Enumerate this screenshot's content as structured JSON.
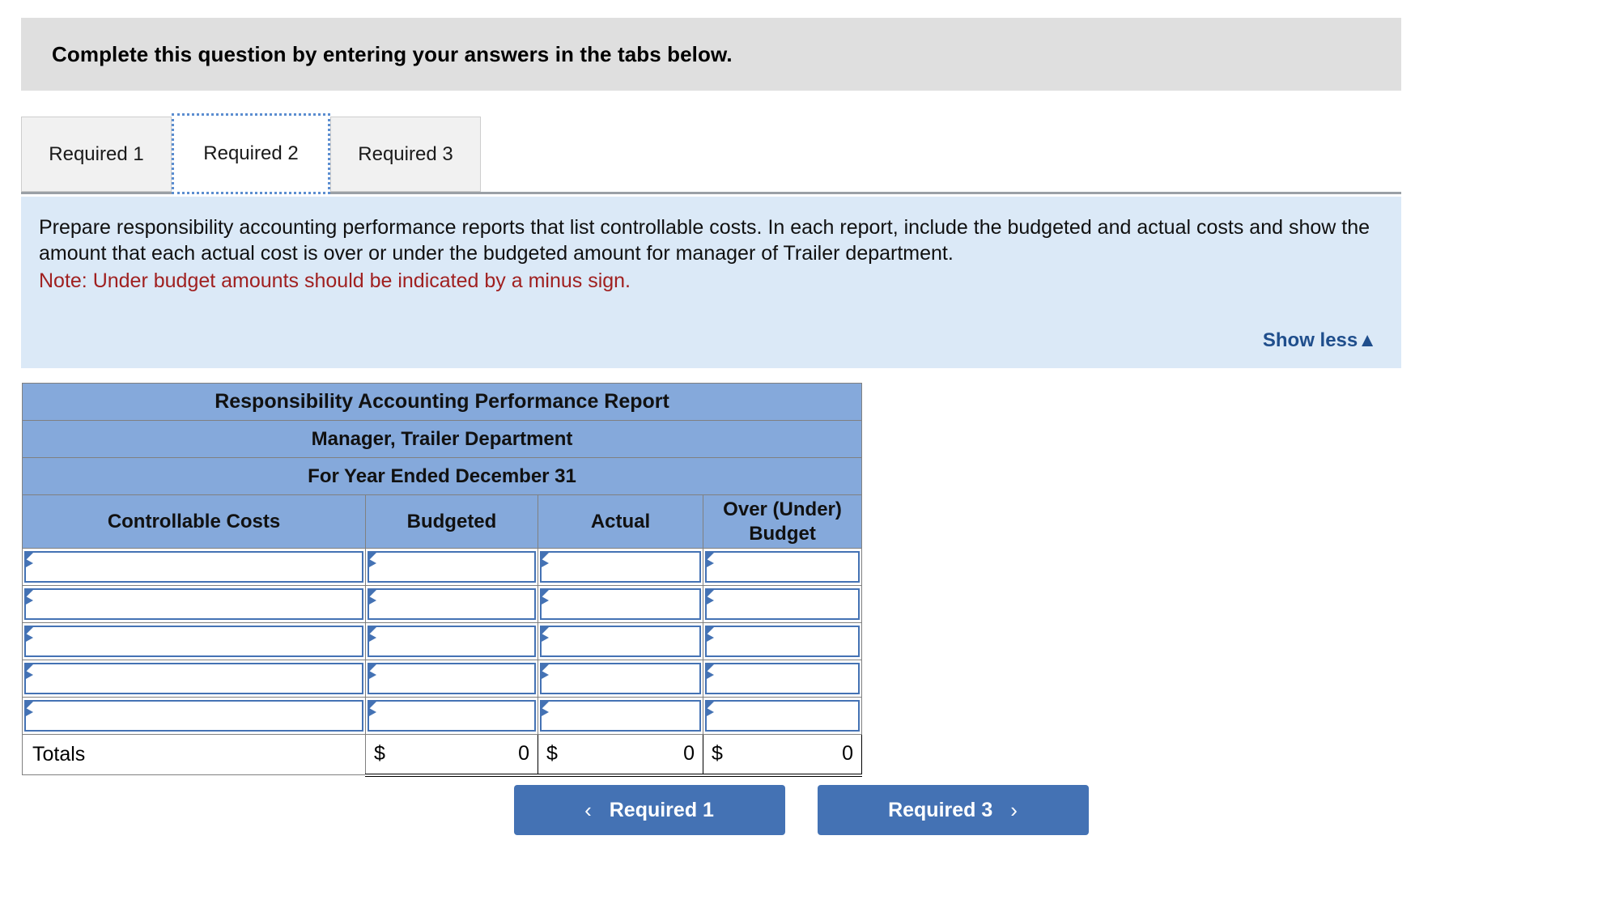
{
  "banner": {
    "text": "Complete this question by entering your answers in the tabs below."
  },
  "tabs": [
    {
      "label": "Required 1",
      "selected": false
    },
    {
      "label": "Required 2",
      "selected": true
    },
    {
      "label": "Required 3",
      "selected": false
    }
  ],
  "instructions": {
    "body": "Prepare responsibility accounting performance reports that list controllable costs. In each report, include the budgeted and actual costs and show the amount that each actual cost is over or under the budgeted amount for manager of Trailer department.",
    "note": "Note: Under budget amounts should be indicated by a minus sign.",
    "show_less_label": "Show less",
    "show_less_icon": "▲"
  },
  "report": {
    "title": "Responsibility Accounting Performance Report",
    "subtitle1": "Manager, Trailer Department",
    "subtitle2": "For Year Ended December 31",
    "columns": [
      "Controllable Costs",
      "Budgeted",
      "Actual",
      "Over (Under) Budget"
    ],
    "input_rows": [
      {
        "cost": "",
        "budgeted": "",
        "actual": "",
        "over_under": ""
      },
      {
        "cost": "",
        "budgeted": "",
        "actual": "",
        "over_under": ""
      },
      {
        "cost": "",
        "budgeted": "",
        "actual": "",
        "over_under": ""
      },
      {
        "cost": "",
        "budgeted": "",
        "actual": "",
        "over_under": ""
      },
      {
        "cost": "",
        "budgeted": "",
        "actual": "",
        "over_under": ""
      }
    ],
    "totals": {
      "label": "Totals",
      "currency": "$",
      "budgeted": "0",
      "actual": "0",
      "over_under": "0"
    }
  },
  "navigation": {
    "prev_label": "Required 1",
    "prev_icon": "‹",
    "next_label": "Required 3",
    "next_icon": "›"
  },
  "colors": {
    "banner_bg": "#dfdfdf",
    "panel_bg": "#dbe9f7",
    "table_header_bg": "#85a9db",
    "accent_blue": "#4472b4",
    "link_blue": "#1f4e8c",
    "note_red": "#a02020"
  }
}
